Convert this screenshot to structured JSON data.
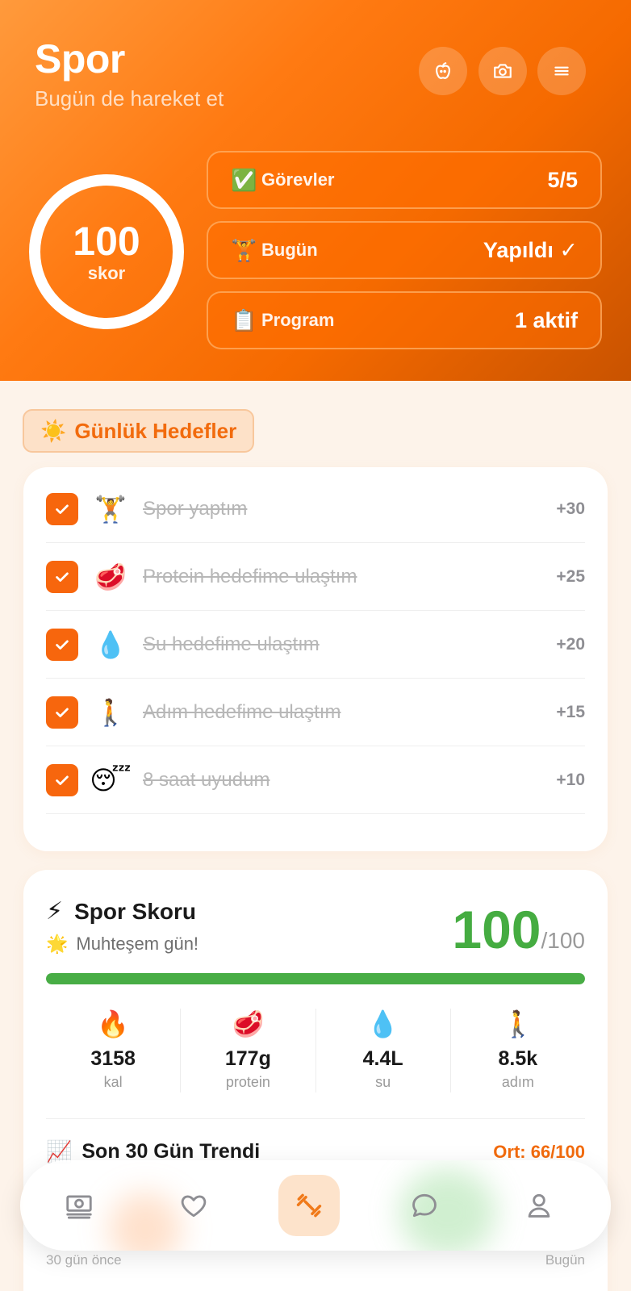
{
  "header": {
    "title": "Spor",
    "subtitle": "Bugün de hareket et",
    "icons": [
      "apple-icon",
      "camera-icon",
      "menu-icon"
    ],
    "score": {
      "value": "100",
      "label": "skor",
      "ring_fraction": 1.0
    },
    "stats": [
      {
        "emoji": "✅",
        "label": "Görevler",
        "value": "5/5"
      },
      {
        "emoji": "🏋️",
        "label": "Bugün",
        "value": "Yapıldı ✓"
      },
      {
        "emoji": "📋",
        "label": "Program",
        "value": "1 aktif"
      }
    ]
  },
  "daily_goals": {
    "emoji": "☀️",
    "title": "Günlük Hedefler",
    "tasks": [
      {
        "emoji": "🏋️",
        "text": "Spor yaptım",
        "points": "+30",
        "done": true
      },
      {
        "emoji": "🥩",
        "text": "Protein hedefime ulaştım",
        "points": "+25",
        "done": true
      },
      {
        "emoji": "💧",
        "text": "Su hedefime ulaştım",
        "points": "+20",
        "done": true
      },
      {
        "emoji": "🚶",
        "text": "Adım hedefime ulaştım",
        "points": "+15",
        "done": true
      },
      {
        "emoji": "😴",
        "text": "8 saat uyudum",
        "points": "+10",
        "done": true
      }
    ]
  },
  "sport_score": {
    "emoji": "⚡",
    "title": "Spor Skoru",
    "sub_emoji": "🌟",
    "subtitle": "Muhteşem gün!",
    "value": "100",
    "max": "/100",
    "progress": 1.0,
    "metrics": [
      {
        "emoji": "🔥",
        "value": "3158",
        "label": "kal"
      },
      {
        "emoji": "🥩",
        "value": "177g",
        "label": "protein"
      },
      {
        "emoji": "💧",
        "value": "4.4L",
        "label": "su"
      },
      {
        "emoji": "🚶",
        "value": "8.5k",
        "label": "adım"
      }
    ],
    "trend": {
      "emoji": "📈",
      "title": "Son 30 Gün Trendi",
      "average": "Ort: 66/100",
      "start_label": "30 gün önce",
      "end_label": "Bugün"
    }
  },
  "nav": {
    "items": [
      {
        "icon": "money-icon",
        "active": false
      },
      {
        "icon": "heart-icon",
        "active": false
      },
      {
        "icon": "dumbbell-icon",
        "active": true
      },
      {
        "icon": "chat-icon",
        "active": false
      },
      {
        "icon": "profile-icon",
        "active": false
      }
    ]
  },
  "colors": {
    "accent": "#f7660d",
    "success": "#45ac41",
    "header_gradient": [
      "#ff9a3c",
      "#c95300"
    ]
  }
}
